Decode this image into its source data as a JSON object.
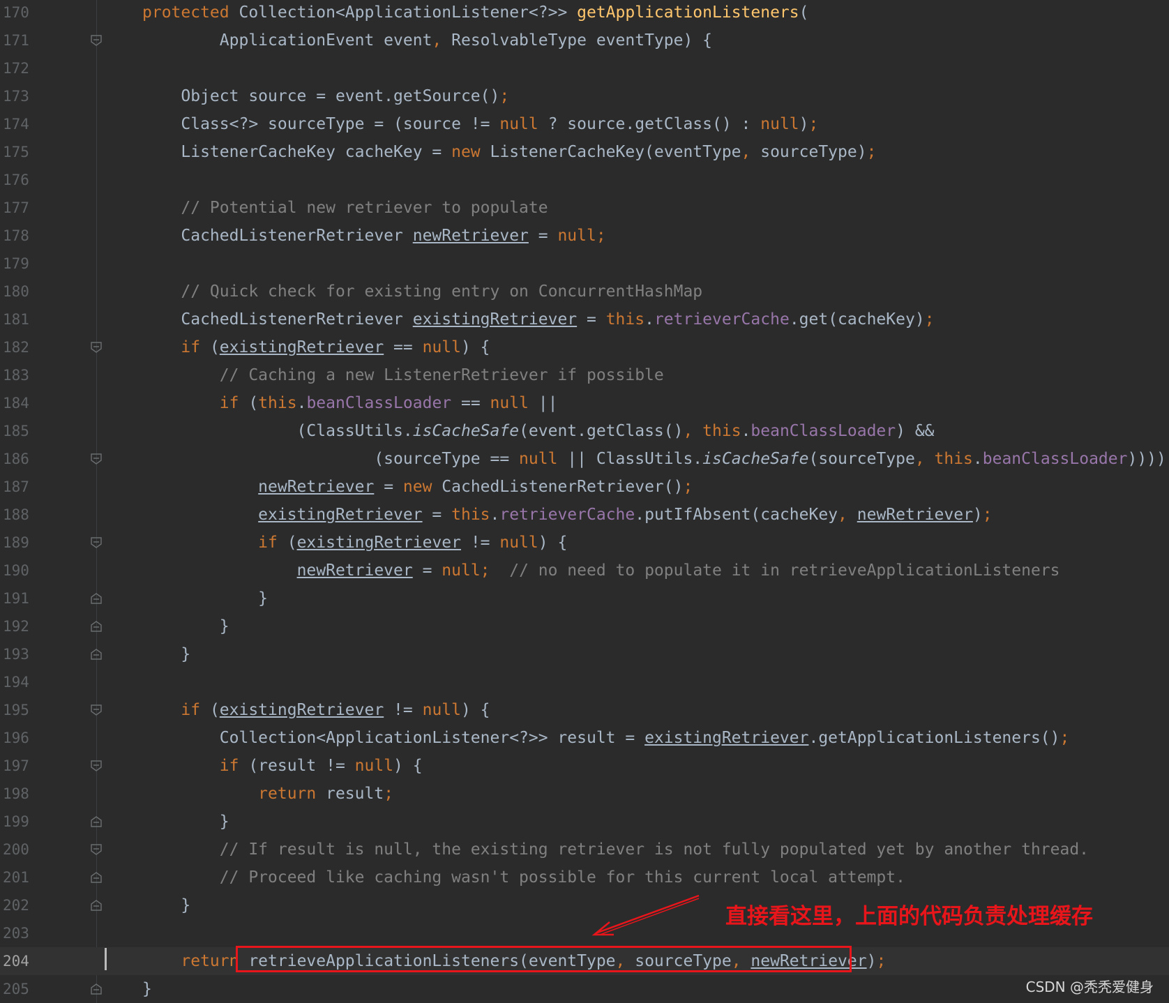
{
  "editor": {
    "current_line": "204",
    "lines": [
      {
        "num": "170",
        "fold": "none",
        "tokens": [
          [
            "kw",
            "protected "
          ],
          [
            "p",
            "Collection<ApplicationListener<?>> "
          ],
          [
            "fn",
            "getApplicationListeners"
          ],
          [
            "p",
            "("
          ]
        ]
      },
      {
        "num": "171",
        "fold": "open",
        "tokens": [
          [
            "p",
            "        ApplicationEvent event"
          ],
          [
            "kw",
            ", "
          ],
          [
            "p",
            "ResolvableType eventType) {"
          ]
        ]
      },
      {
        "num": "172",
        "fold": "none",
        "tokens": []
      },
      {
        "num": "173",
        "fold": "none",
        "tokens": [
          [
            "p",
            "    Object source = event.getSource()"
          ],
          [
            "kw",
            ";"
          ]
        ]
      },
      {
        "num": "174",
        "fold": "none",
        "tokens": [
          [
            "p",
            "    Class<?> sourceType = (source != "
          ],
          [
            "kw",
            "null"
          ],
          [
            "p",
            " ? source.getClass() : "
          ],
          [
            "kw",
            "null"
          ],
          [
            "p",
            ")"
          ],
          [
            "kw",
            ";"
          ]
        ]
      },
      {
        "num": "175",
        "fold": "none",
        "tokens": [
          [
            "p",
            "    ListenerCacheKey cacheKey = "
          ],
          [
            "kw",
            "new "
          ],
          [
            "p",
            "ListenerCacheKey(eventType"
          ],
          [
            "kw",
            ", "
          ],
          [
            "p",
            "sourceType)"
          ],
          [
            "kw",
            ";"
          ]
        ]
      },
      {
        "num": "176",
        "fold": "none",
        "tokens": []
      },
      {
        "num": "177",
        "fold": "none",
        "tokens": [
          [
            "cm",
            "    // Potential new retriever to populate"
          ]
        ]
      },
      {
        "num": "178",
        "fold": "none",
        "tokens": [
          [
            "p",
            "    CachedListenerRetriever "
          ],
          [
            "ul",
            "newRetriever"
          ],
          [
            "p",
            " = "
          ],
          [
            "kw",
            "null;"
          ]
        ]
      },
      {
        "num": "179",
        "fold": "none",
        "tokens": []
      },
      {
        "num": "180",
        "fold": "none",
        "tokens": [
          [
            "cm",
            "    // Quick check for existing entry on ConcurrentHashMap"
          ]
        ]
      },
      {
        "num": "181",
        "fold": "none",
        "tokens": [
          [
            "p",
            "    CachedListenerRetriever "
          ],
          [
            "ul",
            "existingRetriever"
          ],
          [
            "p",
            " = "
          ],
          [
            "kw",
            "this"
          ],
          [
            "p",
            "."
          ],
          [
            "fld",
            "retrieverCache"
          ],
          [
            "p",
            ".get(cacheKey)"
          ],
          [
            "kw",
            ";"
          ]
        ]
      },
      {
        "num": "182",
        "fold": "open",
        "tokens": [
          [
            "kw",
            "    if "
          ],
          [
            "p",
            "("
          ],
          [
            "ul",
            "existingRetriever"
          ],
          [
            "p",
            " == "
          ],
          [
            "kw",
            "null"
          ],
          [
            "p",
            ") {"
          ]
        ]
      },
      {
        "num": "183",
        "fold": "none",
        "tokens": [
          [
            "cm",
            "        // Caching a new ListenerRetriever if possible"
          ]
        ]
      },
      {
        "num": "184",
        "fold": "none",
        "tokens": [
          [
            "kw",
            "        if "
          ],
          [
            "p",
            "("
          ],
          [
            "kw",
            "this"
          ],
          [
            "p",
            "."
          ],
          [
            "fld",
            "beanClassLoader"
          ],
          [
            "p",
            " == "
          ],
          [
            "kw",
            "null"
          ],
          [
            "p",
            " ||"
          ]
        ]
      },
      {
        "num": "185",
        "fold": "none",
        "tokens": [
          [
            "p",
            "                (ClassUtils."
          ],
          [
            "it",
            "isCacheSafe"
          ],
          [
            "p",
            "(event.getClass()"
          ],
          [
            "kw",
            ", this"
          ],
          [
            "p",
            "."
          ],
          [
            "fld",
            "beanClassLoader"
          ],
          [
            "p",
            ") &&"
          ]
        ]
      },
      {
        "num": "186",
        "fold": "open",
        "tokens": [
          [
            "p",
            "                        (sourceType == "
          ],
          [
            "kw",
            "null"
          ],
          [
            "p",
            " || ClassUtils."
          ],
          [
            "it",
            "isCacheSafe"
          ],
          [
            "p",
            "(sourceType"
          ],
          [
            "kw",
            ", this"
          ],
          [
            "p",
            "."
          ],
          [
            "fld",
            "beanClassLoader"
          ],
          [
            "p",
            ")))) {"
          ]
        ]
      },
      {
        "num": "187",
        "fold": "none",
        "tokens": [
          [
            "p",
            "            "
          ],
          [
            "ul",
            "newRetriever"
          ],
          [
            "p",
            " = "
          ],
          [
            "kw",
            "new "
          ],
          [
            "p",
            "CachedListenerRetriever()"
          ],
          [
            "kw",
            ";"
          ]
        ]
      },
      {
        "num": "188",
        "fold": "none",
        "tokens": [
          [
            "p",
            "            "
          ],
          [
            "ul",
            "existingRetriever"
          ],
          [
            "p",
            " = "
          ],
          [
            "kw",
            "this"
          ],
          [
            "p",
            "."
          ],
          [
            "fld",
            "retrieverCache"
          ],
          [
            "p",
            ".putIfAbsent(cacheKey"
          ],
          [
            "kw",
            ", "
          ],
          [
            "ul",
            "newRetriever"
          ],
          [
            "p",
            ")"
          ],
          [
            "kw",
            ";"
          ]
        ]
      },
      {
        "num": "189",
        "fold": "open",
        "tokens": [
          [
            "kw",
            "            if "
          ],
          [
            "p",
            "("
          ],
          [
            "ul",
            "existingRetriever"
          ],
          [
            "p",
            " != "
          ],
          [
            "kw",
            "null"
          ],
          [
            "p",
            ") {"
          ]
        ]
      },
      {
        "num": "190",
        "fold": "none",
        "tokens": [
          [
            "p",
            "                "
          ],
          [
            "ul",
            "newRetriever"
          ],
          [
            "p",
            " = "
          ],
          [
            "kw",
            "null;"
          ],
          [
            "cm",
            "  // no need to populate it in retrieveApplicationListeners"
          ]
        ]
      },
      {
        "num": "191",
        "fold": "close",
        "tokens": [
          [
            "p",
            "            }"
          ]
        ]
      },
      {
        "num": "192",
        "fold": "close",
        "tokens": [
          [
            "p",
            "        }"
          ]
        ]
      },
      {
        "num": "193",
        "fold": "close",
        "tokens": [
          [
            "p",
            "    }"
          ]
        ]
      },
      {
        "num": "194",
        "fold": "none",
        "tokens": []
      },
      {
        "num": "195",
        "fold": "open",
        "tokens": [
          [
            "kw",
            "    if "
          ],
          [
            "p",
            "("
          ],
          [
            "ul",
            "existingRetriever"
          ],
          [
            "p",
            " != "
          ],
          [
            "kw",
            "null"
          ],
          [
            "p",
            ") {"
          ]
        ]
      },
      {
        "num": "196",
        "fold": "none",
        "tokens": [
          [
            "p",
            "        Collection<ApplicationListener<?>> result = "
          ],
          [
            "ul",
            "existingRetriever"
          ],
          [
            "p",
            ".getApplicationListeners()"
          ],
          [
            "kw",
            ";"
          ]
        ]
      },
      {
        "num": "197",
        "fold": "open",
        "tokens": [
          [
            "kw",
            "        if "
          ],
          [
            "p",
            "(result != "
          ],
          [
            "kw",
            "null"
          ],
          [
            "p",
            ") {"
          ]
        ]
      },
      {
        "num": "198",
        "fold": "none",
        "tokens": [
          [
            "kw",
            "            return "
          ],
          [
            "p",
            "result"
          ],
          [
            "kw",
            ";"
          ]
        ]
      },
      {
        "num": "199",
        "fold": "close",
        "tokens": [
          [
            "p",
            "        }"
          ]
        ]
      },
      {
        "num": "200",
        "fold": "open",
        "tokens": [
          [
            "cm",
            "        // If result is null, the existing retriever is not fully populated yet by another thread."
          ]
        ]
      },
      {
        "num": "201",
        "fold": "close",
        "tokens": [
          [
            "cm",
            "        // Proceed like caching wasn't possible for this current local attempt."
          ]
        ]
      },
      {
        "num": "202",
        "fold": "close",
        "tokens": [
          [
            "p",
            "    }"
          ]
        ]
      },
      {
        "num": "203",
        "fold": "none",
        "tokens": []
      },
      {
        "num": "204",
        "fold": "none",
        "tokens": [
          [
            "kw",
            "    return "
          ],
          [
            "p",
            "retrieveApplicationListeners(eventType"
          ],
          [
            "kw",
            ", "
          ],
          [
            "p",
            "sourceType"
          ],
          [
            "kw",
            ", "
          ],
          [
            "ul",
            "newRetriever"
          ],
          [
            "p",
            ")"
          ],
          [
            "kw",
            ";"
          ]
        ]
      },
      {
        "num": "205",
        "fold": "close",
        "tokens": [
          [
            "p",
            "}"
          ]
        ]
      }
    ]
  },
  "annotation": {
    "text": "直接看这里，上面的代码负责处理缓存",
    "color": "#e8151b"
  },
  "watermark": "CSDN @秃秃爱健身"
}
